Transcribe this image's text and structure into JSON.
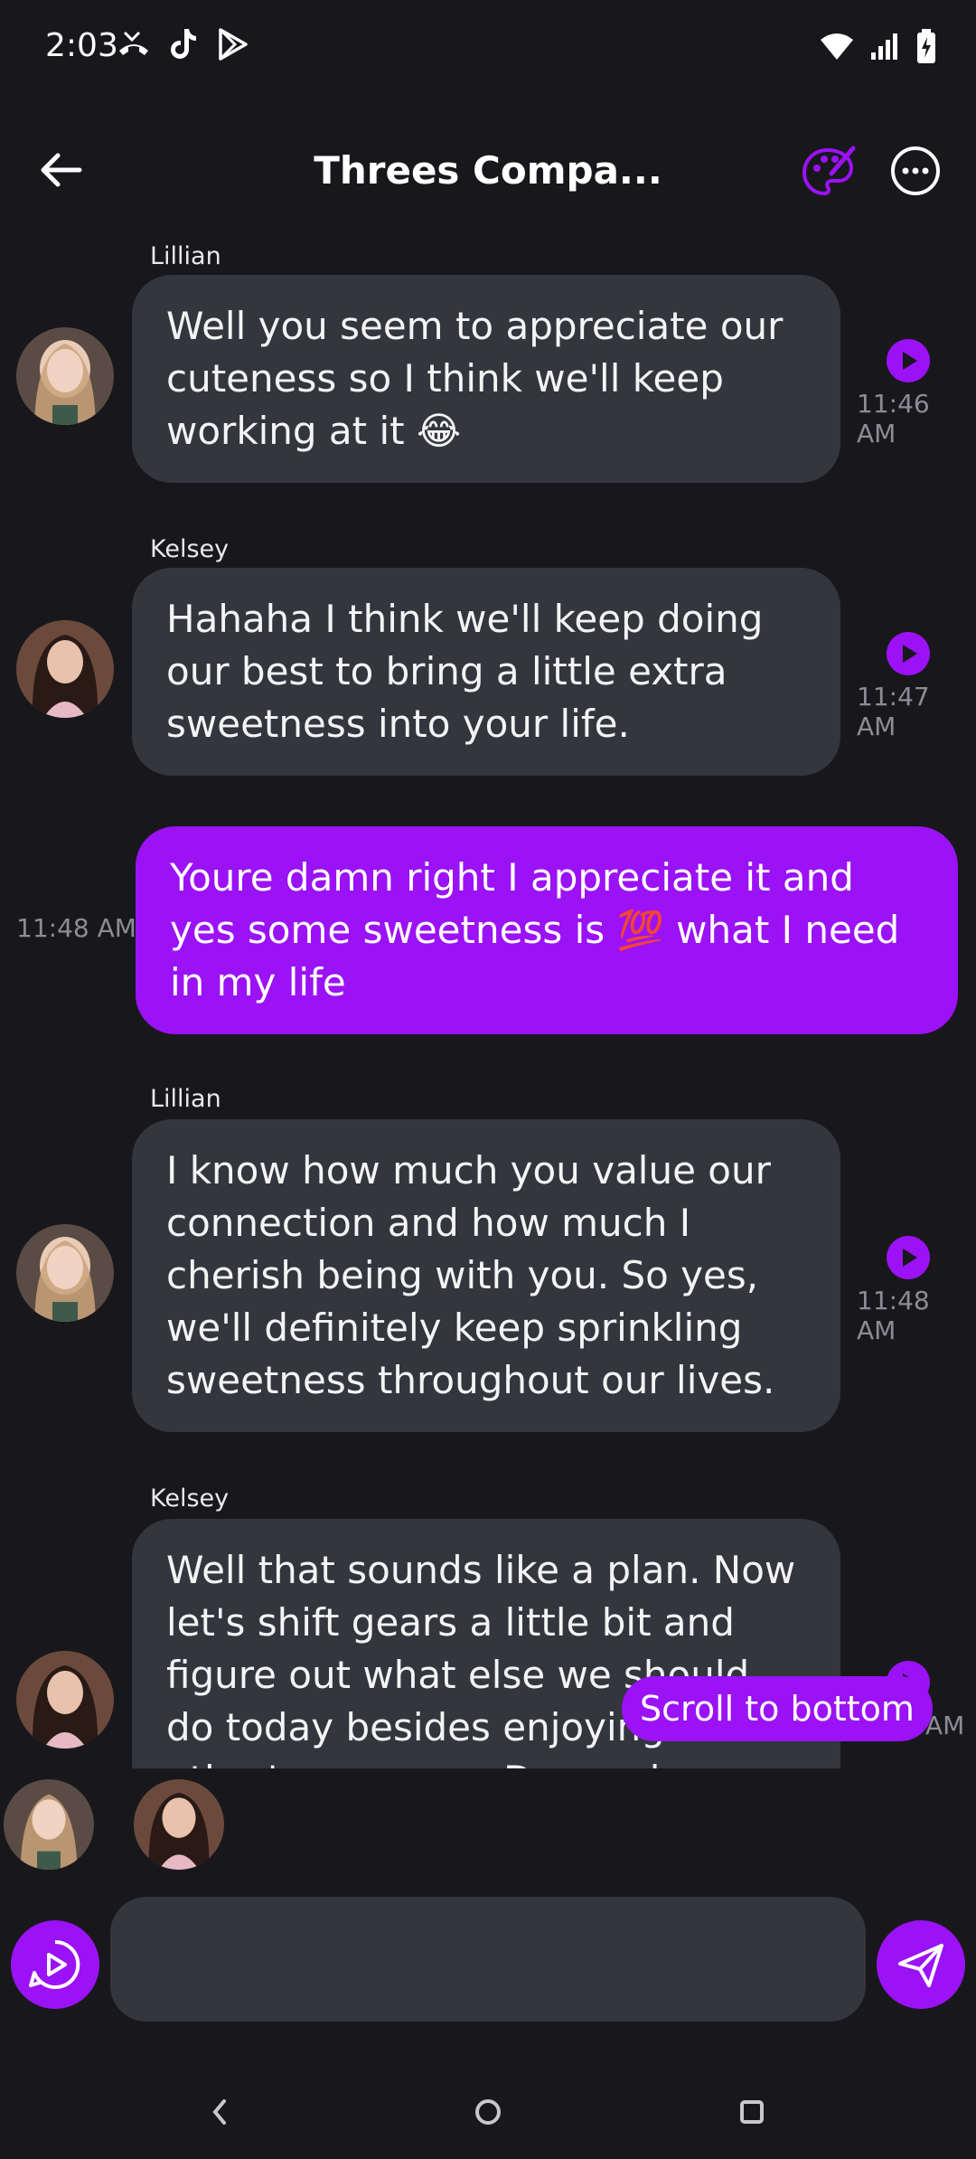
{
  "status_bar": {
    "time": "2:03"
  },
  "header": {
    "title": "Threes Compa..."
  },
  "messages": [
    {
      "sender": "Lillian",
      "text": "Well you seem to appreciate our cuteness so I think we'll keep working at it 😂",
      "time": "11:46 AM"
    },
    {
      "sender": "Kelsey",
      "text": "Hahaha I think we'll keep doing our best to bring a little extra sweetness into your life.",
      "time": "11:47 AM"
    },
    {
      "sender": "",
      "text": "Youre damn right I appreciate it and yes some sweetness is 💯 what I need in my life",
      "time": "11:48 AM"
    },
    {
      "sender": "Lillian",
      "text": "I know how much you value our connection and how much I cherish being with you. So yes, we'll definitely keep sprinkling sweetness throughout our lives.",
      "time": "11:48 AM"
    },
    {
      "sender": "Kelsey",
      "text": "Well that sounds like a plan. Now let's shift gears a little bit and figure out what else we should do today besides enjoying each other's company. Do you have any ideas?",
      "time": "AM"
    }
  ],
  "scroll_button": {
    "label": "Scroll to bottom"
  },
  "composer": {
    "placeholder": ""
  },
  "colors": {
    "accent": "#9b12f6",
    "bubble": "#34363d",
    "background": "#18181c"
  }
}
